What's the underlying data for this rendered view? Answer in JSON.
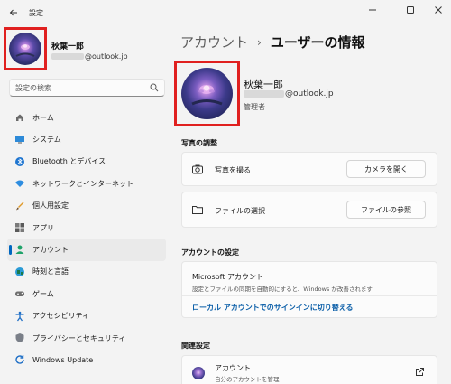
{
  "window": {
    "title": "設定"
  },
  "sidebar": {
    "user_name": "秋葉一郎",
    "user_email_suffix": "@outlook.jp",
    "search_placeholder": "設定の検索",
    "items": [
      {
        "label": "ホーム",
        "icon": "home-icon"
      },
      {
        "label": "システム",
        "icon": "monitor-icon"
      },
      {
        "label": "Bluetooth とデバイス",
        "icon": "bluetooth-icon"
      },
      {
        "label": "ネットワークとインターネット",
        "icon": "wifi-icon"
      },
      {
        "label": "個人用設定",
        "icon": "brush-icon"
      },
      {
        "label": "アプリ",
        "icon": "apps-icon"
      },
      {
        "label": "アカウント",
        "icon": "person-icon",
        "active": true
      },
      {
        "label": "時刻と言語",
        "icon": "globe-icon"
      },
      {
        "label": "ゲーム",
        "icon": "gamepad-icon"
      },
      {
        "label": "アクセシビリティ",
        "icon": "accessibility-icon"
      },
      {
        "label": "プライバシーとセキュリティ",
        "icon": "shield-icon"
      },
      {
        "label": "Windows Update",
        "icon": "update-icon"
      }
    ]
  },
  "main": {
    "breadcrumb_parent": "アカウント",
    "breadcrumb_sep": "›",
    "breadcrumb_current": "ユーザーの情報",
    "profile": {
      "name": "秋葉一郎",
      "email_suffix": "@outlook.jp",
      "role": "管理者"
    },
    "photo_section": {
      "title": "写真の調整",
      "rows": [
        {
          "label": "写真を撮る",
          "button": "カメラを開く",
          "icon": "camera-icon"
        },
        {
          "label": "ファイルの選択",
          "button": "ファイルの参照",
          "icon": "folder-icon"
        }
      ]
    },
    "account_section": {
      "title": "アカウントの設定",
      "ms_title": "Microsoft アカウント",
      "ms_desc": "設定とファイルの同期を自動的にすると、Windows が改善されます",
      "ms_link": "ローカル アカウントでのサインインに切り替える"
    },
    "related_section": {
      "title": "関連設定",
      "item_title": "アカウント",
      "item_sub": "自分のアカウントを管理"
    }
  },
  "colors": {
    "accent": "#0067c0",
    "highlight_frame": "#e0201f",
    "link": "#0a5ea8"
  }
}
